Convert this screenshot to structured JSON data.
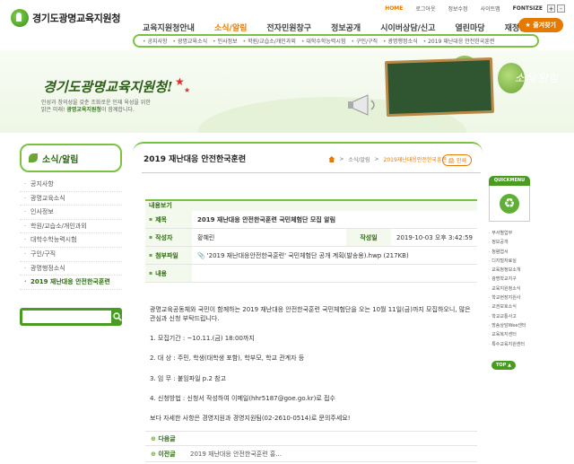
{
  "header": {
    "logo": "경기도광명교육지원청",
    "util": {
      "home": "HOME",
      "login": "로그아웃",
      "sitemap": "정보수정",
      "sitemap2": "사이트맵",
      "fontsize": "FONTSIZE",
      "plus": "+",
      "minus": "-"
    },
    "gnb": [
      "교육지원청안내",
      "소식/알림",
      "전자민원창구",
      "정보공개",
      "시이버상담/신고",
      "열린마당",
      "재정공개"
    ],
    "favorite": "즐겨찾기",
    "subnav": [
      "공지사항",
      "광명교육소식",
      "인사정보",
      "학원/교습소/개인과외",
      "대학수학능력시험",
      "구인/구직",
      "광명행정소식",
      "2019 재난대응 안전한국훈련"
    ]
  },
  "visual": {
    "slogan": "경기도광명교육지원청!",
    "desc_line1": "인성과 창의성을 갖춘 조화로운 인재 육성을 위한",
    "desc_line2_pre": "밝은 미래! ",
    "desc_line2_bold": "광명교육지원청",
    "desc_line2_post": "이 함께합니다.",
    "board_title": "소식/알림"
  },
  "lnb": {
    "title": "소식/알림",
    "items": [
      "공지사항",
      "광명교육소식",
      "인사정보",
      "학원/교습소/개인과외",
      "대학수학능력시험",
      "구인/구직",
      "광명행정소식",
      "2019 재난대응 안전한국훈련"
    ],
    "active": "2019 재난대응 안전한국훈련"
  },
  "content": {
    "title": "2019 재난대응 안전한국훈련",
    "crumb": [
      "소식/알림",
      "2019재난대응안전한국훈련"
    ],
    "print": "인쇄",
    "view_head": "내용보기",
    "labels": {
      "subject": "제목",
      "writer": "작성자",
      "date_label": "작성일",
      "file": "첨부파일",
      "content": "내용"
    },
    "subject": "2019 재난대응 안전한국훈련 국민체험단 모집 알림",
    "writer": "황혜린",
    "date": "2019-10-03 오후 3:42:59",
    "file": "'2019 재난대응안전한국훈련' 국민체험단 공개 계획(발송용).hwp (217KB)",
    "body": {
      "p1": "광명교육공동체와 국민이 함께하는 2019 재난대응 안전한국훈련 국민체험단을 오는 10월 11일(금)까지 모집하오니, 많은 관심과 신청 부탁드립니다.",
      "l1": "1. 모집기간 : ~10.11.(금) 18:00까지",
      "l2": "2. 대      상 : 주민, 학생(대학생 포함), 학부모, 학교 관계자 등",
      "l3": "3. 임      무 : 붙임파일 p.2 참고",
      "l4": "4. 신청방법 : 신청서 작성하여 이메일(hhr5187@goe.go.kr)로 접수",
      "p2": "보다 자세한 사항은 경영지원과 경영지원팀(02-2610-0514)로 문의주세요!"
    },
    "next_label": "다음글",
    "next_value": "",
    "prev_label": "이전글",
    "prev_value": "2019 재난대응 안전한국훈련 홍..."
  },
  "quick": {
    "title": "QUICKMENU",
    "items": [
      "부서별업무",
      "정보공개",
      "청렴엽서",
      "디지털자료실",
      "교육청정보소개",
      "광명학교지구",
      "교육지원청소식",
      "학교현장지원사",
      "교권보호소식",
      "학교교통사고",
      "방송상담Wee센터",
      "교육복지센터",
      "특수교육지원센터"
    ],
    "top": "TOP"
  },
  "colors": {
    "brand_green": "#4a9b22",
    "accent_orange": "#e67a00",
    "frame_green": "#7cc242"
  }
}
